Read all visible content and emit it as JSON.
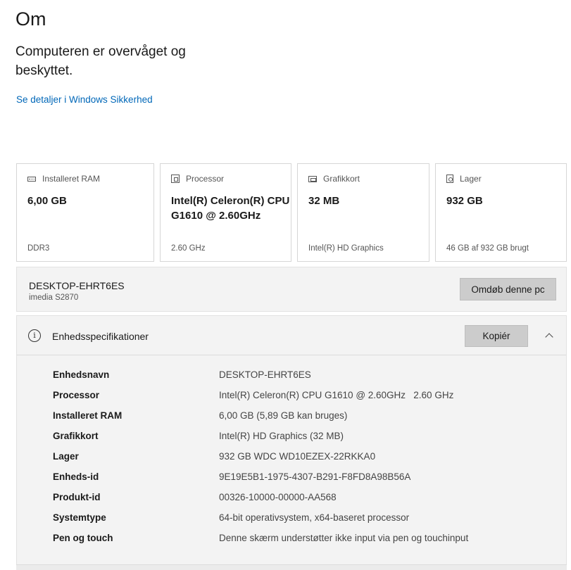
{
  "page": {
    "title": "Om",
    "security_status": "Computeren er overvåget og beskyttet.",
    "security_link": "Se detaljer i Windows Sikkerhed"
  },
  "cards": [
    {
      "icon": "ram-icon",
      "label": "Installeret RAM",
      "value": "6,00 GB",
      "footer": "DDR3"
    },
    {
      "icon": "processor-icon",
      "label": "Processor",
      "value": "Intel(R) Celeron(R) CPU G1610 @ 2.60GHz",
      "footer": "2.60 GHz"
    },
    {
      "icon": "graphics-card-icon",
      "label": "Grafikkort",
      "value": "32 MB",
      "footer": "Intel(R) HD Graphics"
    },
    {
      "icon": "storage-icon",
      "label": "Lager",
      "value": "932 GB",
      "footer": "46 GB af 932 GB brugt"
    }
  ],
  "pc": {
    "name": "DESKTOP-EHRT6ES",
    "model": "imedia S2870",
    "rename_label": "Omdøb denne pc"
  },
  "specs": {
    "title": "Enhedsspecifikationer",
    "copy_label": "Kopiér",
    "rows": [
      {
        "label": "Enhedsnavn",
        "value": "DESKTOP-EHRT6ES"
      },
      {
        "label": "Processor",
        "value": "Intel(R) Celeron(R) CPU G1610 @ 2.60GHz   2.60 GHz"
      },
      {
        "label": "Installeret RAM",
        "value": "6,00 GB (5,89 GB kan bruges)"
      },
      {
        "label": "Grafikkort",
        "value": "Intel(R) HD Graphics (32 MB)"
      },
      {
        "label": "Lager",
        "value": "932 GB WDC WD10EZEX-22RKKA0"
      },
      {
        "label": "Enheds-id",
        "value": "9E19E5B1-1975-4307-B291-F8FD8A98B56A"
      },
      {
        "label": "Produkt-id",
        "value": "00326-10000-00000-AA568"
      },
      {
        "label": "Systemtype",
        "value": "64-bit operativsystem, x64-baseret processor"
      },
      {
        "label": "Pen og touch",
        "value": "Denne skærm understøtter ikke input via pen og touchinput"
      }
    ]
  }
}
